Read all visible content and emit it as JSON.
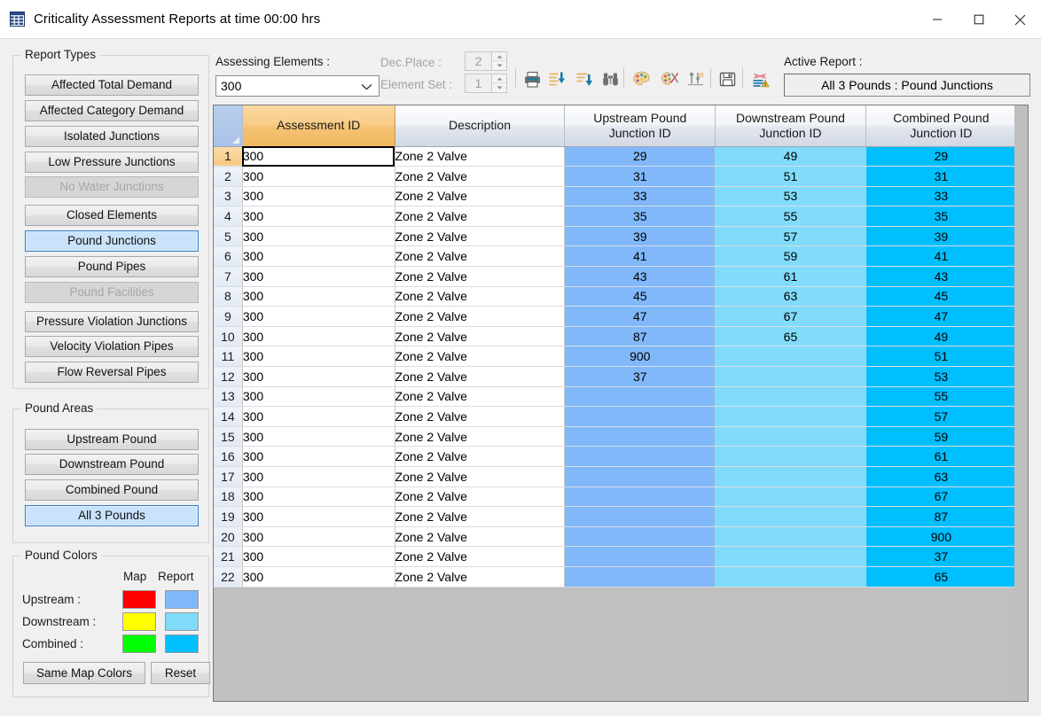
{
  "window": {
    "title": "Criticality Assessment Reports at time 00:00 hrs",
    "icon": "grid-table-icon",
    "minimize_label": "Minimize",
    "maximize_label": "Maximize",
    "close_label": "Close"
  },
  "report_types": {
    "legend": "Report Types",
    "items": [
      {
        "label": "Affected Total Demand",
        "state": "normal"
      },
      {
        "label": "Affected Category Demand",
        "state": "normal"
      },
      {
        "label": "Isolated Junctions",
        "state": "normal"
      },
      {
        "label": "Low Pressure Junctions",
        "state": "normal"
      },
      {
        "label": "No Water Junctions",
        "state": "disabled"
      },
      {
        "label": "Closed Elements",
        "state": "normal"
      },
      {
        "label": "Pound Junctions",
        "state": "selected"
      },
      {
        "label": "Pound Pipes",
        "state": "normal"
      },
      {
        "label": "Pound Facilities",
        "state": "disabled"
      },
      {
        "label": "Pressure Violation Junctions",
        "state": "normal"
      },
      {
        "label": "Velocity Violation Pipes",
        "state": "normal"
      },
      {
        "label": "Flow Reversal Pipes",
        "state": "normal"
      }
    ]
  },
  "pound_areas": {
    "legend": "Pound Areas",
    "items": [
      {
        "label": "Upstream Pound",
        "state": "normal"
      },
      {
        "label": "Downstream Pound",
        "state": "normal"
      },
      {
        "label": "Combined Pound",
        "state": "normal"
      },
      {
        "label": "All 3 Pounds",
        "state": "selected"
      }
    ]
  },
  "pound_colors": {
    "legend": "Pound Colors",
    "col_map": "Map",
    "col_report": "Report",
    "rows": [
      {
        "label": "Upstream :",
        "map": "#ff0000",
        "report": "#80b8fa"
      },
      {
        "label": "Downstream :",
        "map": "#ffff00",
        "report": "#80dcfa"
      },
      {
        "label": "Combined :",
        "map": "#00ff00",
        "report": "#00bfff"
      }
    ],
    "same_map_colors_label": "Same Map Colors",
    "reset_label": "Reset"
  },
  "toolbar": {
    "assessing_elements_label": "Assessing Elements :",
    "assessing_elements_value": "300",
    "dec_place_label": "Dec.Place :",
    "dec_place_value": "2",
    "element_set_label": "Element Set :",
    "element_set_value": "1",
    "icons": [
      {
        "name": "print-icon",
        "title": "Print"
      },
      {
        "name": "sort-ascending-icon",
        "title": "Sort Ascending"
      },
      {
        "name": "sort-descending-icon",
        "title": "Sort Descending"
      },
      {
        "name": "find-binoculars-icon",
        "title": "Find"
      },
      {
        "name": "palette-icon",
        "title": "Colors"
      },
      {
        "name": "palette-clear-icon",
        "title": "Clear Colors"
      },
      {
        "name": "filter-settings-icon",
        "title": "Settings"
      },
      {
        "name": "save-floppy-icon",
        "title": "Save"
      },
      {
        "name": "export-report-icon",
        "title": "Export Report"
      }
    ],
    "active_report_label": "Active Report :",
    "active_report_value": "All 3 Pounds : Pound Junctions"
  },
  "grid": {
    "columns": [
      {
        "key": "rownum",
        "label": "",
        "selected": false
      },
      {
        "key": "assessment_id",
        "label": "Assessment ID",
        "selected": true
      },
      {
        "key": "description",
        "label": "Description",
        "selected": false
      },
      {
        "key": "upstream",
        "label": "Upstream Pound\nJunction ID",
        "selected": false
      },
      {
        "key": "downstream",
        "label": "Downstream Pound\nJunction ID",
        "selected": false
      },
      {
        "key": "combined",
        "label": "Combined Pound\nJunction ID",
        "selected": false
      }
    ],
    "column_labels": {
      "assessment_id": "Assessment ID",
      "description": "Description",
      "upstream_l1": "Upstream Pound",
      "upstream_l2": "Junction ID",
      "downstream_l1": "Downstream Pound",
      "downstream_l2": "Junction ID",
      "combined_l1": "Combined Pound",
      "combined_l2": "Junction ID"
    },
    "active_cell": {
      "row": 1,
      "column": "assessment_id"
    },
    "rows": [
      {
        "n": "1",
        "assessment_id": "300",
        "description": "Zone 2  Valve",
        "upstream": "29",
        "downstream": "49",
        "combined": "29"
      },
      {
        "n": "2",
        "assessment_id": "300",
        "description": "Zone 2  Valve",
        "upstream": "31",
        "downstream": "51",
        "combined": "31"
      },
      {
        "n": "3",
        "assessment_id": "300",
        "description": "Zone 2  Valve",
        "upstream": "33",
        "downstream": "53",
        "combined": "33"
      },
      {
        "n": "4",
        "assessment_id": "300",
        "description": "Zone 2  Valve",
        "upstream": "35",
        "downstream": "55",
        "combined": "35"
      },
      {
        "n": "5",
        "assessment_id": "300",
        "description": "Zone 2  Valve",
        "upstream": "39",
        "downstream": "57",
        "combined": "39"
      },
      {
        "n": "6",
        "assessment_id": "300",
        "description": "Zone 2  Valve",
        "upstream": "41",
        "downstream": "59",
        "combined": "41"
      },
      {
        "n": "7",
        "assessment_id": "300",
        "description": "Zone 2  Valve",
        "upstream": "43",
        "downstream": "61",
        "combined": "43"
      },
      {
        "n": "8",
        "assessment_id": "300",
        "description": "Zone 2  Valve",
        "upstream": "45",
        "downstream": "63",
        "combined": "45"
      },
      {
        "n": "9",
        "assessment_id": "300",
        "description": "Zone 2  Valve",
        "upstream": "47",
        "downstream": "67",
        "combined": "47"
      },
      {
        "n": "10",
        "assessment_id": "300",
        "description": "Zone 2  Valve",
        "upstream": "87",
        "downstream": "65",
        "combined": "49"
      },
      {
        "n": "11",
        "assessment_id": "300",
        "description": "Zone 2  Valve",
        "upstream": "900",
        "downstream": "",
        "combined": "51"
      },
      {
        "n": "12",
        "assessment_id": "300",
        "description": "Zone 2  Valve",
        "upstream": "37",
        "downstream": "",
        "combined": "53"
      },
      {
        "n": "13",
        "assessment_id": "300",
        "description": "Zone 2  Valve",
        "upstream": "",
        "downstream": "",
        "combined": "55"
      },
      {
        "n": "14",
        "assessment_id": "300",
        "description": "Zone 2  Valve",
        "upstream": "",
        "downstream": "",
        "combined": "57"
      },
      {
        "n": "15",
        "assessment_id": "300",
        "description": "Zone 2  Valve",
        "upstream": "",
        "downstream": "",
        "combined": "59"
      },
      {
        "n": "16",
        "assessment_id": "300",
        "description": "Zone 2  Valve",
        "upstream": "",
        "downstream": "",
        "combined": "61"
      },
      {
        "n": "17",
        "assessment_id": "300",
        "description": "Zone 2  Valve",
        "upstream": "",
        "downstream": "",
        "combined": "63"
      },
      {
        "n": "18",
        "assessment_id": "300",
        "description": "Zone 2  Valve",
        "upstream": "",
        "downstream": "",
        "combined": "67"
      },
      {
        "n": "19",
        "assessment_id": "300",
        "description": "Zone 2  Valve",
        "upstream": "",
        "downstream": "",
        "combined": "87"
      },
      {
        "n": "20",
        "assessment_id": "300",
        "description": "Zone 2  Valve",
        "upstream": "",
        "downstream": "",
        "combined": "900"
      },
      {
        "n": "21",
        "assessment_id": "300",
        "description": "Zone 2  Valve",
        "upstream": "",
        "downstream": "",
        "combined": "37"
      },
      {
        "n": "22",
        "assessment_id": "300",
        "description": "Zone 2  Valve",
        "upstream": "",
        "downstream": "",
        "combined": "65"
      }
    ]
  }
}
